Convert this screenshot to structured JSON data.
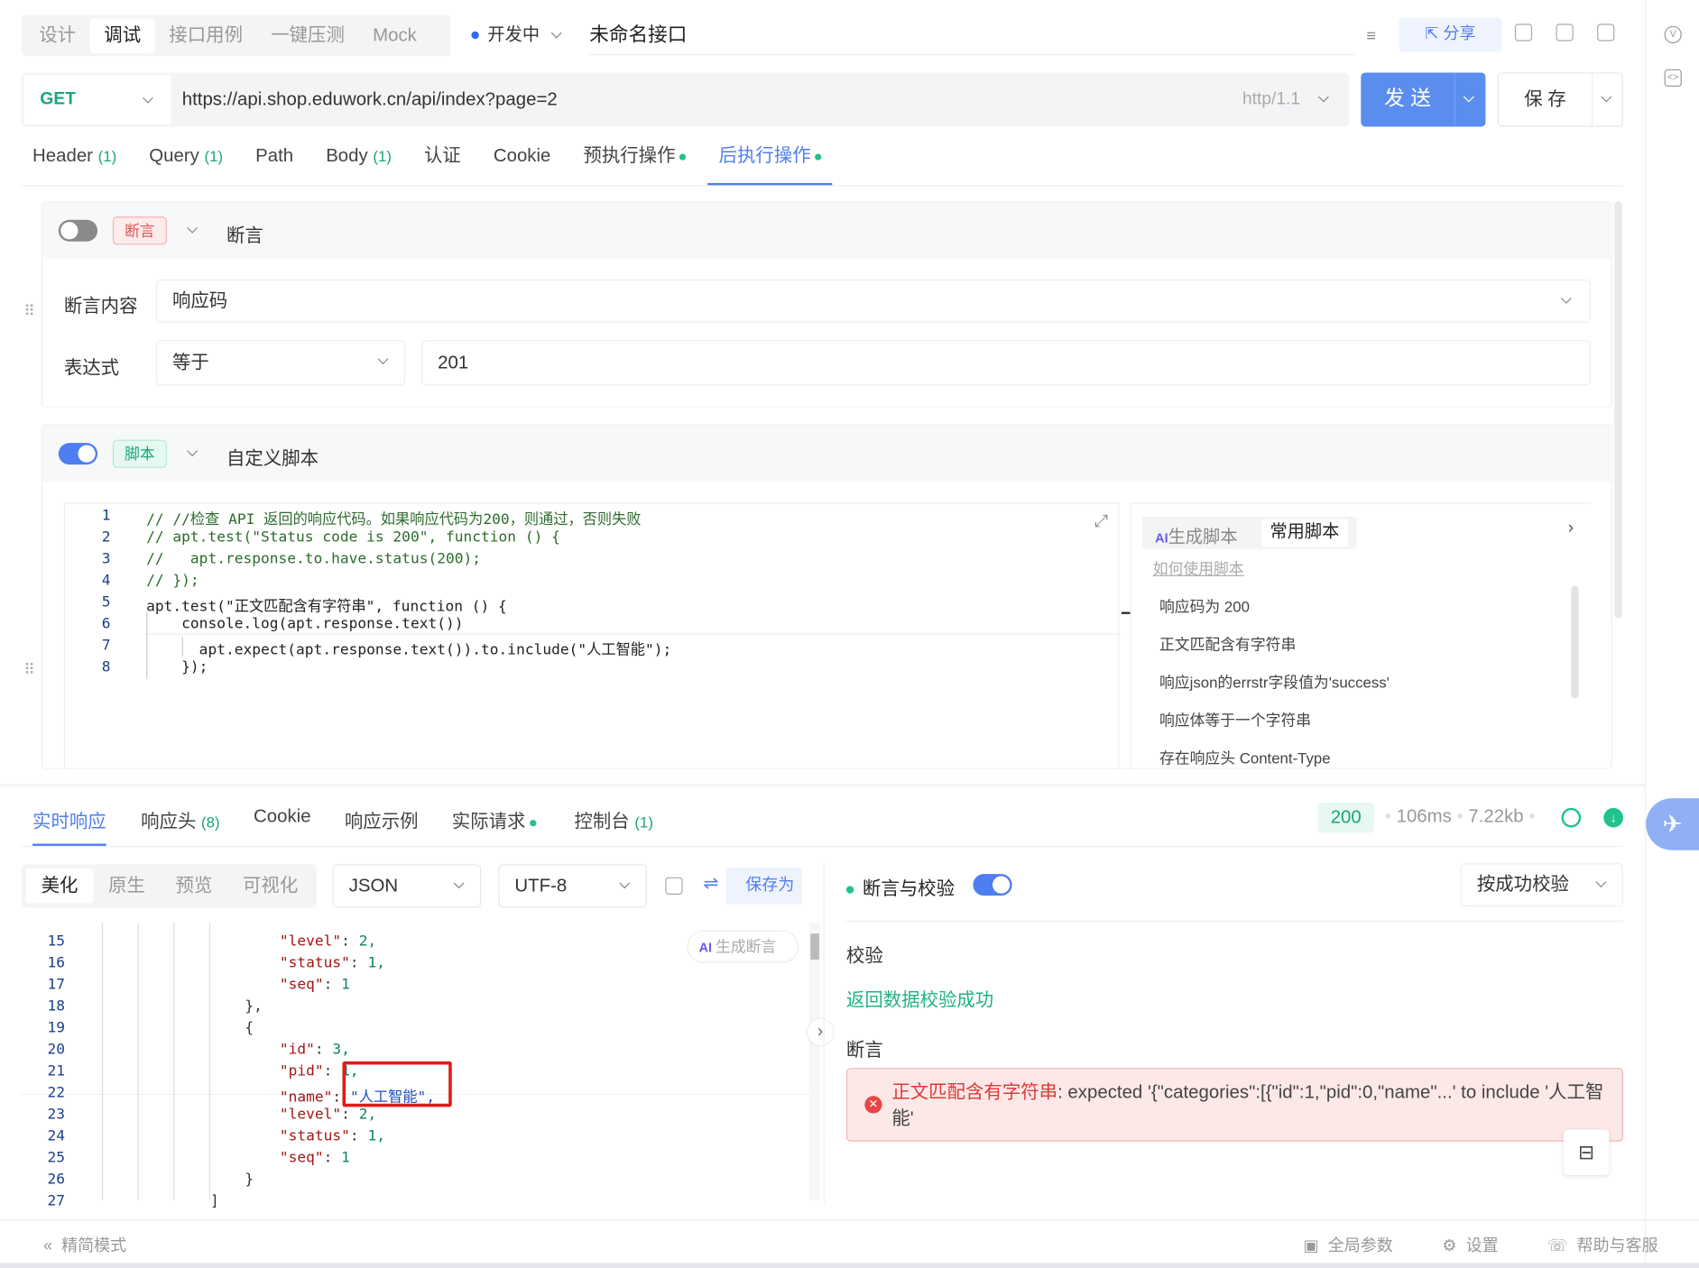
{
  "top": {
    "mode_tabs": [
      "设计",
      "调试",
      "接口用例",
      "一键压测",
      "Mock"
    ],
    "active_mode": "调试",
    "status_label": "开发中",
    "status_color": "#2f6bf6",
    "api_name": "未命名接口",
    "share_label": "分享"
  },
  "request": {
    "method": "GET",
    "url": "https://api.shop.eduwork.cn/api/index?page=2",
    "protocol": "http/1.1",
    "send_label": "发 送",
    "save_label": "保 存"
  },
  "req_tabs": [
    {
      "label": "Header",
      "count": "(1)"
    },
    {
      "label": "Query",
      "count": "(1)"
    },
    {
      "label": "Path",
      "count": ""
    },
    {
      "label": "Body",
      "count": "(1)"
    },
    {
      "label": "认证",
      "count": ""
    },
    {
      "label": "Cookie",
      "count": ""
    },
    {
      "label": "预执行操作",
      "count": ""
    },
    {
      "label": "后执行操作",
      "count": ""
    }
  ],
  "assertion": {
    "tag": "断言",
    "title": "断言",
    "content_label": "断言内容",
    "content_value": "响应码",
    "expr_label": "表达式",
    "expr_value": "等于",
    "expected_value": "201"
  },
  "script": {
    "tag": "脚本",
    "title": "自定义脚本",
    "line_numbers": [
      "1",
      "2",
      "3",
      "4",
      "5",
      "6",
      "7",
      "8"
    ],
    "lines": [
      "// //检查 API 返回的响应代码。如果响应代码为200，则通过，否则失败",
      "// apt.test(\"Status code is 200\", function () {",
      "//   apt.response.to.have.status(200);",
      "// });",
      "apt.test(\"正文匹配含有字符串\", function () {",
      "    console.log(apt.response.text())",
      "      apt.expect(apt.response.text()).to.include(\"人工智能\");",
      "    });"
    ],
    "ai_gen_label": "生成脚本",
    "common_label": "常用脚本",
    "howto_label": "如何使用脚本",
    "suggestions": [
      "响应码为 200",
      "正文匹配含有字符串",
      "响应json的errstr字段值为'success'",
      "响应体等于一个字符串",
      "存在响应头 Content-Type"
    ]
  },
  "response": {
    "tabs": [
      {
        "label": "实时响应",
        "count": ""
      },
      {
        "label": "响应头",
        "count": "(8)"
      },
      {
        "label": "Cookie",
        "count": ""
      },
      {
        "label": "响应示例",
        "count": ""
      },
      {
        "label": "实际请求",
        "count": ""
      },
      {
        "label": "控制台",
        "count": "(1)"
      }
    ],
    "status_code": "200",
    "time": "106ms",
    "size": "7.22kb",
    "view_modes": [
      "美化",
      "原生",
      "预览",
      "可视化"
    ],
    "format": "JSON",
    "encoding": "UTF-8",
    "save_as_label": "保存为",
    "gen_assert_label": "生成断言",
    "line_numbers": [
      "15",
      "16",
      "17",
      "18",
      "19",
      "20",
      "21",
      "22",
      "23",
      "24",
      "25",
      "26",
      "27"
    ],
    "json_lines": [
      {
        "k": "\"level\"",
        "v": "2,"
      },
      {
        "k": "\"status\"",
        "v": "1,"
      },
      {
        "k": "\"seq\"",
        "v": "1"
      },
      {
        "k": "",
        "v": "},"
      },
      {
        "k": "",
        "v": "{"
      },
      {
        "k": "\"id\"",
        "v": "3,"
      },
      {
        "k": "\"pid\"",
        "v": "1,"
      },
      {
        "k": "\"name\"",
        "v": "\"人工智能\","
      },
      {
        "k": "\"level\"",
        "v": "2,"
      },
      {
        "k": "\"status\"",
        "v": "1,"
      },
      {
        "k": "\"seq\"",
        "v": "1"
      },
      {
        "k": "",
        "v": "}"
      },
      {
        "k": "",
        "v": "]"
      }
    ]
  },
  "validation": {
    "title": "断言与校验",
    "mode": "按成功校验",
    "check_label": "校验",
    "check_result": "返回数据校验成功",
    "assert_label": "断言",
    "error_name": "正文匹配含有字符串",
    "error_text": ": expected '{\"categories\":[{\"id\":1,\"pid\":0,\"name\"...' to include '人工智能'"
  },
  "footer": {
    "simple_mode": "精简模式",
    "global_params": "全局参数",
    "settings": "设置",
    "help": "帮助与客服"
  }
}
